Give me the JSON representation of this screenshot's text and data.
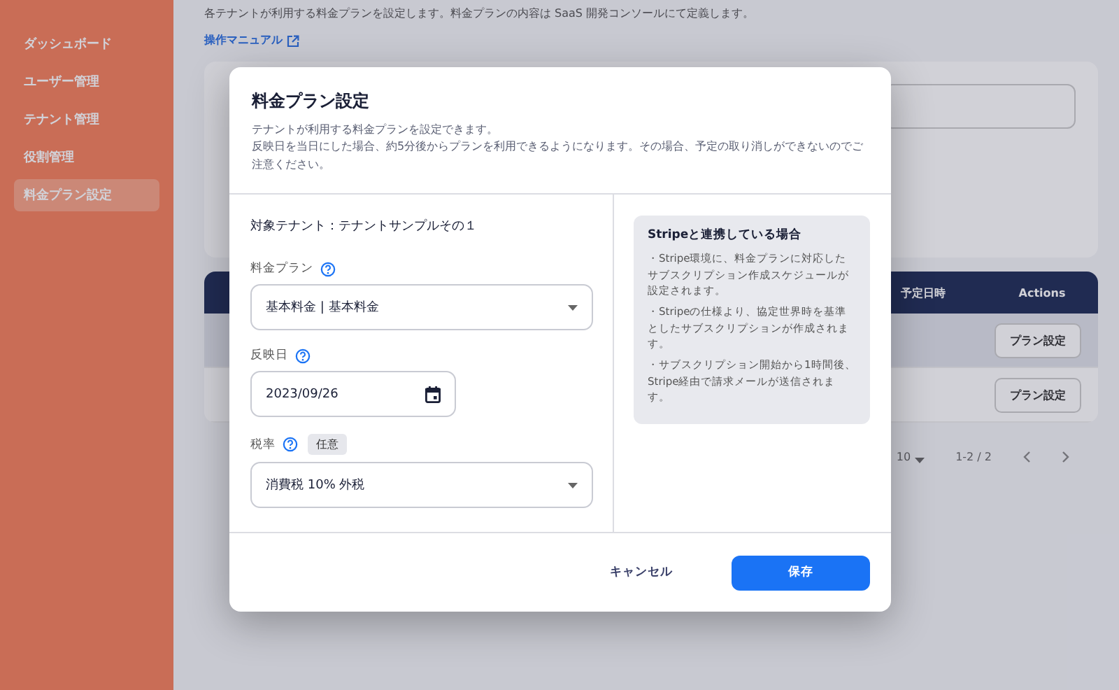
{
  "sidebar": {
    "items": [
      {
        "label": "ダッシュボード",
        "selected": false
      },
      {
        "label": "ユーザー管理",
        "selected": false
      },
      {
        "label": "テナント管理",
        "selected": false
      },
      {
        "label": "役割管理",
        "selected": false
      },
      {
        "label": "料金プラン設定",
        "selected": true
      }
    ]
  },
  "page": {
    "description": "各テナントが利用する料金プランを設定します。料金プランの内容は SaaS 開発コンソールにて定義します。",
    "manual_link": "操作マニュアル"
  },
  "table": {
    "columns": [
      "予定日時",
      "Actions"
    ],
    "rows": [
      {
        "action": "プラン設定",
        "selected": true
      },
      {
        "action": "プラン設定",
        "selected": false
      }
    ]
  },
  "pagination": {
    "page_size": "10",
    "range": "1-2 / 2"
  },
  "dialog": {
    "title": "料金プラン設定",
    "description": [
      "テナントが利用する料金プランを設定できます。",
      "反映日を当日にした場合、約5分後からプランを利用できるようになります。その場合、予定の取り消しができないのでご注意ください。"
    ],
    "target": "対象テナント：テナントサンプルその１",
    "fields": [
      {
        "kind": "select",
        "label": "料金プラン",
        "value": "基本料金 | 基本料金"
      },
      {
        "kind": "date",
        "label": "反映日",
        "value": "2023/09/26"
      },
      {
        "kind": "select",
        "label": "税率",
        "badge": "任意",
        "value": "消費税 10% 外税"
      }
    ],
    "info": {
      "title": "Stripeと連携している場合",
      "items": [
        "・Stripe環境に、料金プランに対応したサブスクリプション作成スケジュールが設定されます。",
        "・Stripeの仕様より、協定世界時を基準としたサブスクリプションが作成されます。",
        "・サブスクリプション開始から1時間後、Stripe経由で請求メールが送信されます。"
      ]
    },
    "buttons": [
      {
        "kind": "secondary",
        "label": "キャンセル"
      },
      {
        "kind": "primary",
        "label": "保存"
      }
    ]
  }
}
